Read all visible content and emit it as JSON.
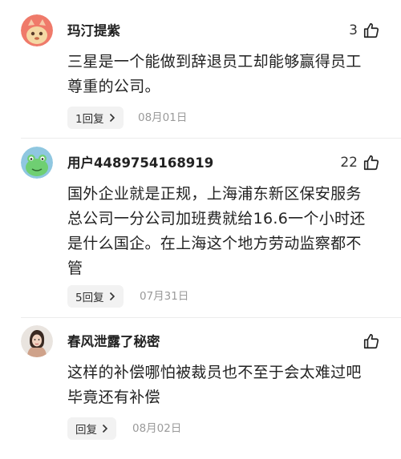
{
  "comments": [
    {
      "username": "玛汀提紫",
      "likes": "3",
      "text_lines": [
        "三星是一个能做到辞退员工却能够赢得员工",
        "尊重的公司。"
      ],
      "reply_label": "1回复",
      "date": "08月01日",
      "avatar_icon": "orange-fox-avatar"
    },
    {
      "username": "用户4489754168919",
      "likes": "22",
      "text_lines": [
        "国外企业就是正规，上海浦东新区保安服务",
        "总公司一分公司加班费就给16.6一个小时还",
        "是什么国企。在上海这个地方劳动监察都不",
        "管"
      ],
      "reply_label": "5回复",
      "date": "07月31日",
      "avatar_icon": "green-frog-avatar"
    },
    {
      "username": "春风泄露了秘密",
      "likes": "",
      "text_lines": [
        "这样的补偿哪怕被裁员也不至于会太难过吧",
        "毕竟还有补偿"
      ],
      "reply_label": "回复",
      "date": "08月02日",
      "avatar_icon": "person-photo-avatar"
    }
  ]
}
